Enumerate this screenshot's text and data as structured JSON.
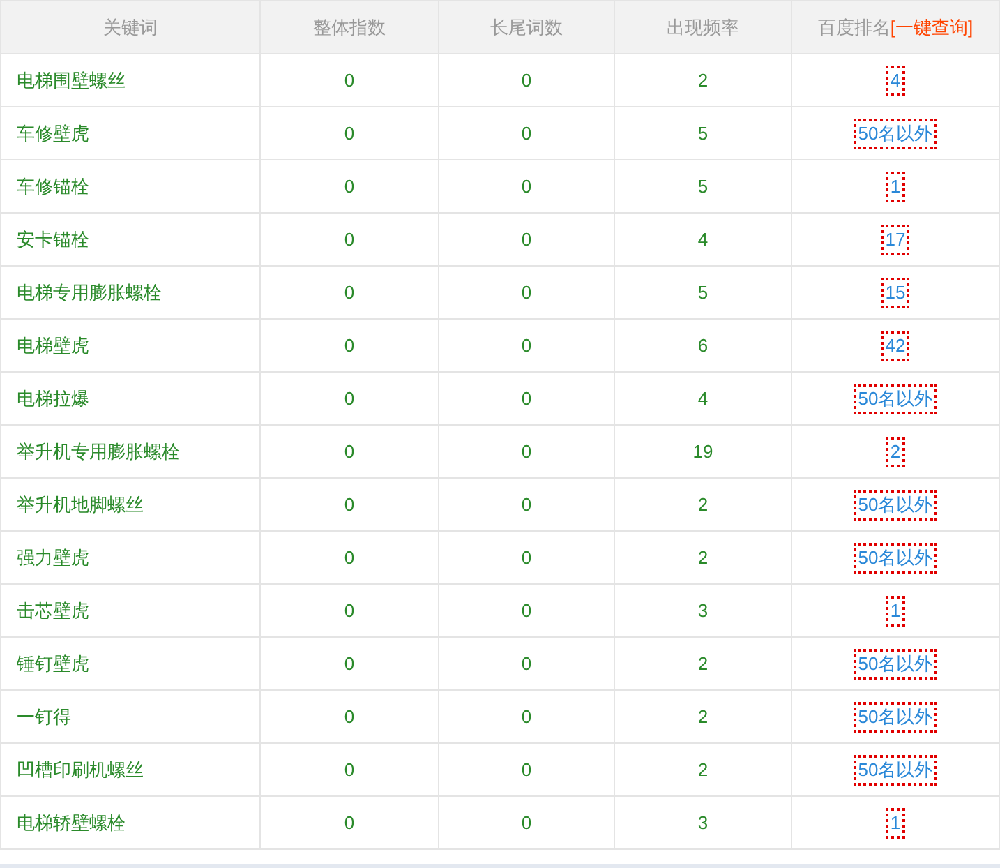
{
  "table": {
    "columns": [
      "关键词",
      "整体指数",
      "长尾词数",
      "出现频率"
    ],
    "rank_column": {
      "label": "百度排名",
      "action": "[一键查询]"
    },
    "rows": [
      {
        "keyword": "电梯围壁螺丝",
        "overall": "0",
        "longtail": "0",
        "frequency": "2",
        "rank": "4"
      },
      {
        "keyword": "车修壁虎",
        "overall": "0",
        "longtail": "0",
        "frequency": "5",
        "rank": "50名以外"
      },
      {
        "keyword": "车修锚栓",
        "overall": "0",
        "longtail": "0",
        "frequency": "5",
        "rank": "1"
      },
      {
        "keyword": "安卡锚栓",
        "overall": "0",
        "longtail": "0",
        "frequency": "4",
        "rank": "17"
      },
      {
        "keyword": "电梯专用膨胀螺栓",
        "overall": "0",
        "longtail": "0",
        "frequency": "5",
        "rank": "15"
      },
      {
        "keyword": "电梯壁虎",
        "overall": "0",
        "longtail": "0",
        "frequency": "6",
        "rank": "42"
      },
      {
        "keyword": "电梯拉爆",
        "overall": "0",
        "longtail": "0",
        "frequency": "4",
        "rank": "50名以外"
      },
      {
        "keyword": "举升机专用膨胀螺栓",
        "overall": "0",
        "longtail": "0",
        "frequency": "19",
        "rank": "2"
      },
      {
        "keyword": "举升机地脚螺丝",
        "overall": "0",
        "longtail": "0",
        "frequency": "2",
        "rank": "50名以外"
      },
      {
        "keyword": "强力壁虎",
        "overall": "0",
        "longtail": "0",
        "frequency": "2",
        "rank": "50名以外"
      },
      {
        "keyword": "击芯壁虎",
        "overall": "0",
        "longtail": "0",
        "frequency": "3",
        "rank": "1"
      },
      {
        "keyword": "锤钉壁虎",
        "overall": "0",
        "longtail": "0",
        "frequency": "2",
        "rank": "50名以外"
      },
      {
        "keyword": "一钉得",
        "overall": "0",
        "longtail": "0",
        "frequency": "2",
        "rank": "50名以外"
      },
      {
        "keyword": "凹槽印刷机螺丝",
        "overall": "0",
        "longtail": "0",
        "frequency": "2",
        "rank": "50名以外"
      },
      {
        "keyword": "电梯轿壁螺栓",
        "overall": "0",
        "longtail": "0",
        "frequency": "3",
        "rank": "1"
      }
    ]
  }
}
